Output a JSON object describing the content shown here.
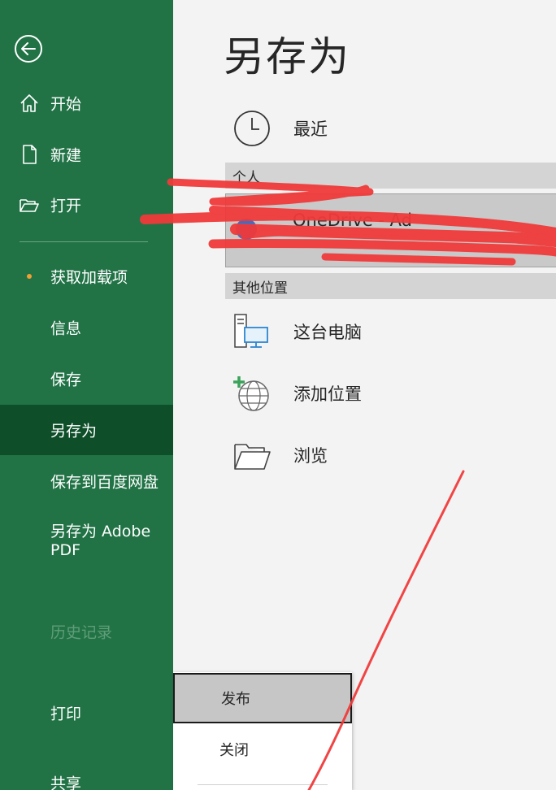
{
  "sidebar": {
    "back_icon": "back-arrow-icon",
    "items": [
      {
        "id": "home",
        "label": "开始",
        "icon": "home-icon"
      },
      {
        "id": "new",
        "label": "新建",
        "icon": "new-file-icon"
      },
      {
        "id": "open",
        "label": "打开",
        "icon": "open-folder-icon"
      },
      {
        "id": "addins",
        "label": "获取加载项",
        "badge": "orange-dot"
      },
      {
        "id": "info",
        "label": "信息"
      },
      {
        "id": "save",
        "label": "保存"
      },
      {
        "id": "save-as",
        "label": "另存为",
        "selected": true
      },
      {
        "id": "save-baidu",
        "label": "保存到百度网盘"
      },
      {
        "id": "save-pdf",
        "label": "另存为 Adobe PDF"
      },
      {
        "id": "history",
        "label": "历史记录",
        "disabled": true
      },
      {
        "id": "print",
        "label": "打印"
      },
      {
        "id": "share",
        "label": "共享"
      }
    ]
  },
  "main": {
    "title": "另存为",
    "recent": {
      "label": "最近",
      "icon": "clock-icon"
    },
    "personal_header": "个人",
    "onedrive_label": "OneDrive - Ad",
    "other_header": "其他位置",
    "locations": [
      {
        "id": "this-pc",
        "label": "这台电脑",
        "icon": "computer-icon"
      },
      {
        "id": "add-place",
        "label": "添加位置",
        "icon": "add-globe-icon"
      },
      {
        "id": "browse",
        "label": "浏览",
        "icon": "folder-browse-icon"
      }
    ]
  },
  "popup": {
    "items": [
      {
        "id": "publish",
        "label": "发布",
        "highlight": true
      },
      {
        "id": "close",
        "label": "关闭"
      }
    ]
  },
  "colors": {
    "sidebar_bg": "#217346",
    "sidebar_selected": "#0e4f2a",
    "content_bg": "#f3f3f3",
    "scribble_red": "#f03a3a",
    "badge_orange": "#f2a033"
  }
}
